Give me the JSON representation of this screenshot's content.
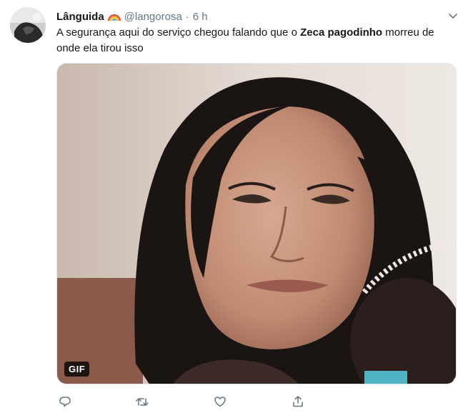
{
  "tweet": {
    "display_name": "Lânguida",
    "name_emoji": "rainbow-icon",
    "handle": "@langorosa",
    "separator": "·",
    "time": "6 h",
    "text_before": "A segurança aqui do serviço chegou falando que o ",
    "text_bold": "Zeca pagodinho",
    "text_after": " morreu de onde ela tirou isso",
    "media": {
      "badge": "GIF"
    }
  },
  "actions": [
    "reply-icon",
    "retweet-icon",
    "like-icon",
    "share-icon"
  ],
  "colors": {
    "text": "#14171a",
    "secondary": "#657786",
    "icon": "#657786"
  }
}
